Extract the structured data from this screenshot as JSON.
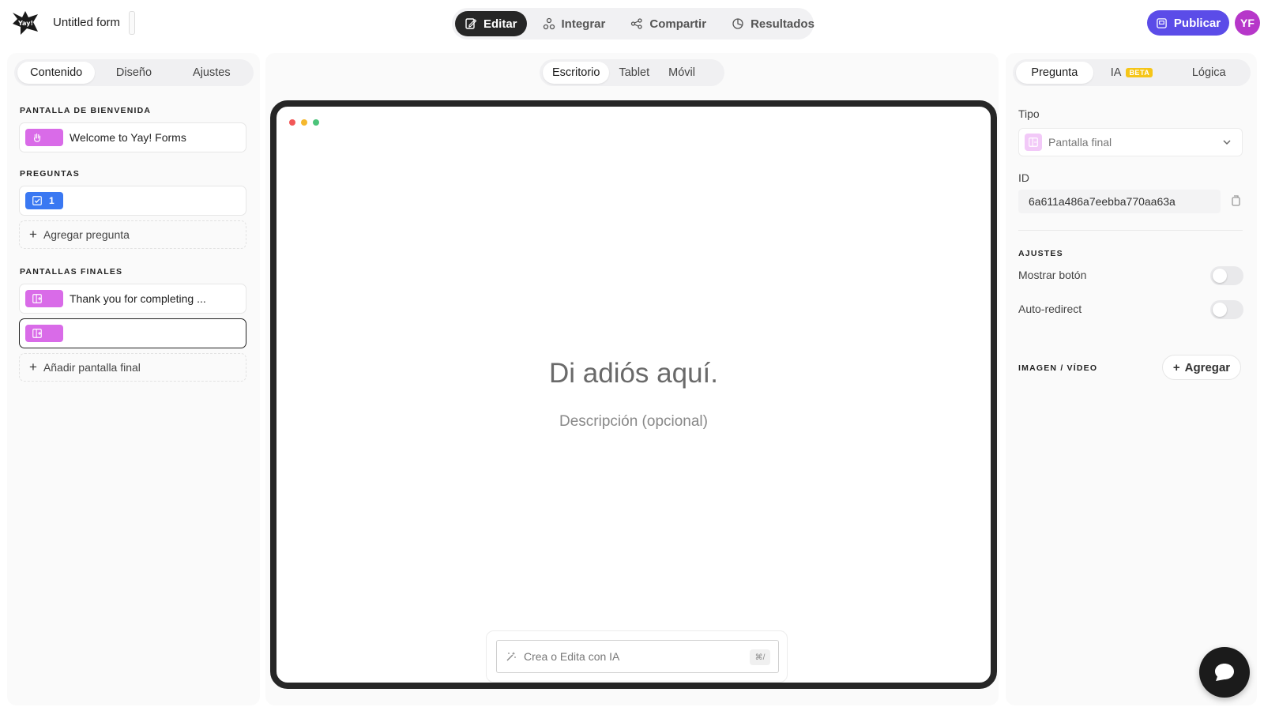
{
  "header": {
    "form_title": "Untitled form",
    "mode_tabs": [
      {
        "label": "Editar",
        "icon": "edit-icon",
        "active": true
      },
      {
        "label": "Integrar",
        "icon": "integrations-icon",
        "active": false
      },
      {
        "label": "Compartir",
        "icon": "share-icon",
        "active": false
      },
      {
        "label": "Resultados",
        "icon": "results-icon",
        "active": false
      }
    ],
    "publish_label": "Publicar",
    "avatar_initials": "YF"
  },
  "left_panel": {
    "tabs": [
      "Contenido",
      "Diseño",
      "Ajustes"
    ],
    "active_tab": "Contenido",
    "welcome_section_label": "PANTALLA DE BIENVENIDA",
    "welcome_item": "Welcome to Yay! Forms",
    "questions_section_label": "PREGUNTAS",
    "question_number": "1",
    "add_question_label": "Agregar pregunta",
    "endings_section_label": "PANTALLAS FINALES",
    "ending_item": "Thank you for completing ...",
    "add_ending_label": "Añadir pantalla final"
  },
  "center": {
    "device_tabs": [
      "Escritorio",
      "Tablet",
      "Móvil"
    ],
    "active_device": "Escritorio",
    "goodbye_title": "Di adiós aquí.",
    "goodbye_description": "Descripción (opcional)",
    "ai_placeholder": "Crea o Edita con IA",
    "ai_shortcut": "⌘/"
  },
  "right_panel": {
    "tabs": {
      "question": "Pregunta",
      "ai": "IA",
      "ai_badge": "BETA",
      "logic": "Lógica"
    },
    "type_label": "Tipo",
    "type_value": "Pantalla final",
    "id_label": "ID",
    "id_value": "6a611a486a7eebba770aa63a",
    "settings_label": "AJUSTES",
    "show_button_label": "Mostrar botón",
    "auto_redirect_label": "Auto-redirect",
    "media_label": "IMAGEN / VÍDEO",
    "media_add_label": "Agregar"
  },
  "colors": {
    "accent": "#5b4ce8",
    "avatar": "#b637c9",
    "chip_pink": "#d96be8",
    "chip_blue": "#3a78f2"
  }
}
